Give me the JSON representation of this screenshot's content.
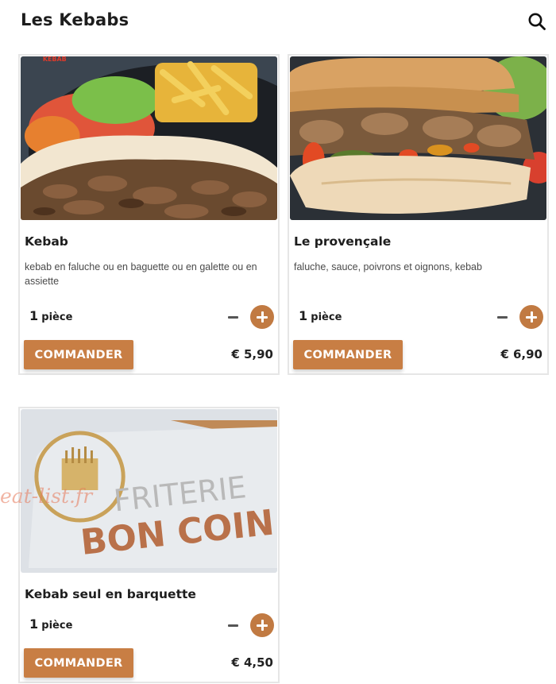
{
  "header": {
    "title": "Les Kebabs",
    "search_icon": "search-icon"
  },
  "products": [
    {
      "name": "Kebab",
      "description": "kebab en faluche ou en baguette ou en galette ou en assiette",
      "qty_number": "1",
      "qty_unit": "pièce",
      "order_label": "COMMANDER",
      "price": "€ 5,90",
      "image_label": "KEBAB"
    },
    {
      "name": "Le provençale",
      "description": "faluche, sauce, poivrons et oignons, kebab",
      "qty_number": "1",
      "qty_unit": "pièce",
      "order_label": "COMMANDER",
      "price": "€ 6,90"
    },
    {
      "name": "Kebab seul en barquette",
      "description": "",
      "qty_number": "1",
      "qty_unit": "pièce",
      "order_label": "COMMANDER",
      "price": "€ 4,50",
      "image_text_top": "FRITERIE",
      "image_text_bottom": "BON COIN"
    }
  ],
  "watermark": "eat-list.fr",
  "colors": {
    "accent": "#c87e44",
    "plus": "#c17a42",
    "border": "#e6e6e6"
  }
}
